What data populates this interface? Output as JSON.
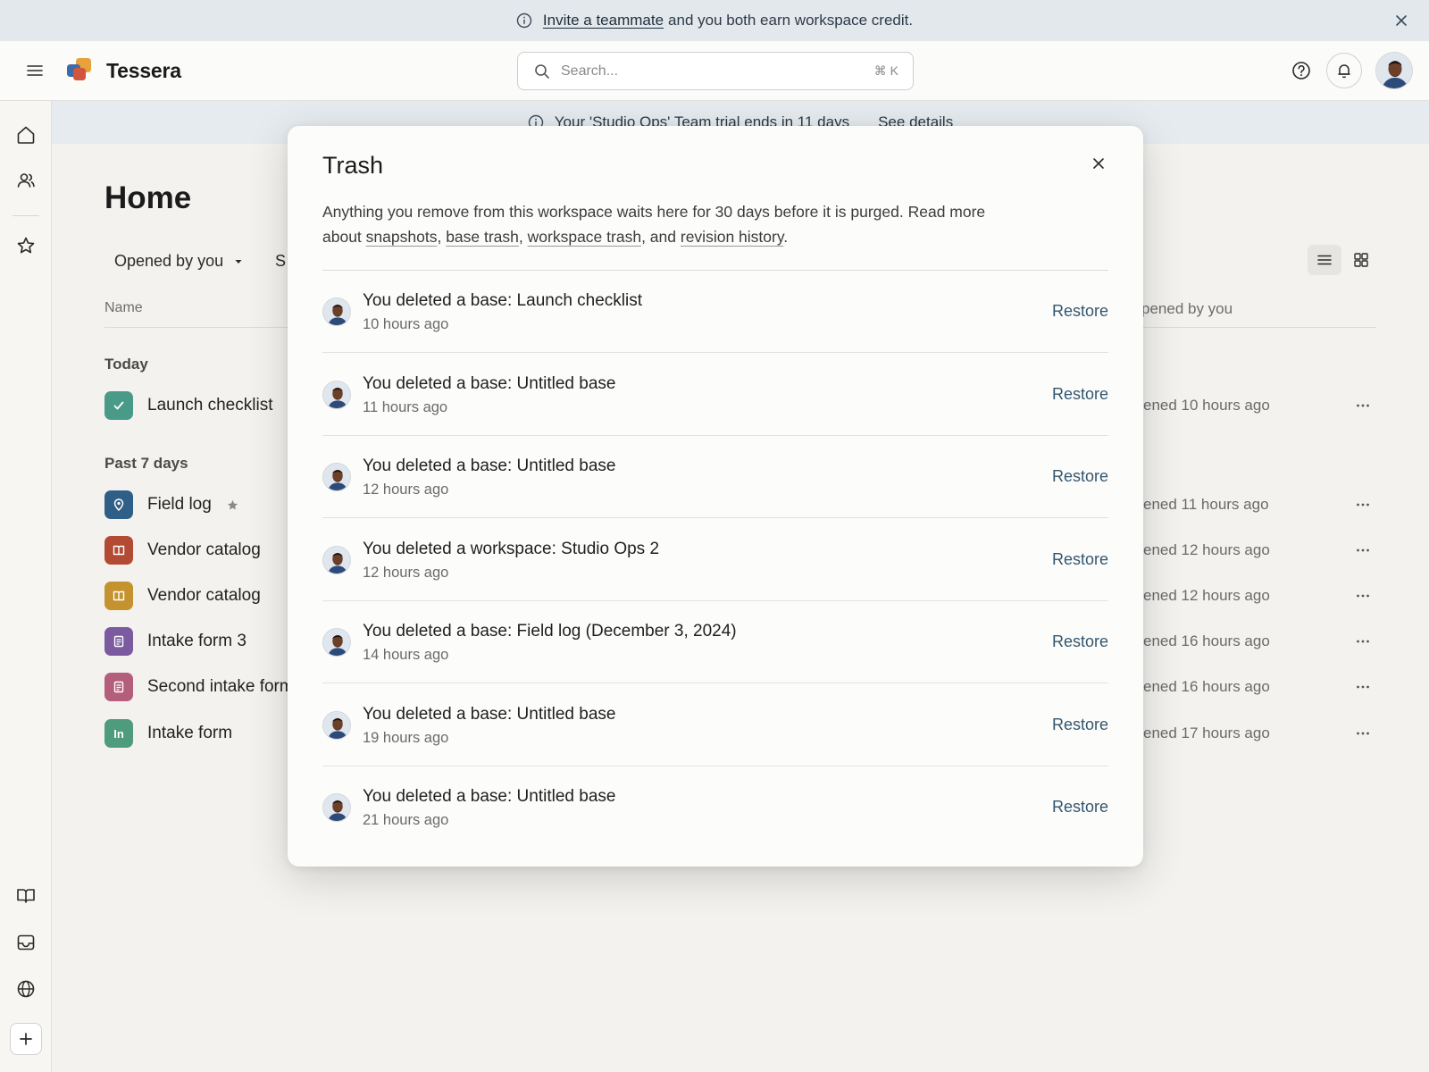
{
  "promo": {
    "link_text": "Invite a teammate",
    "rest_text": "and you both earn workspace credit."
  },
  "header": {
    "brand": "Tessera",
    "search_placeholder": "Search...",
    "search_shortcut": "⌘ K"
  },
  "trial_banner": {
    "text": "Your 'Studio Ops' Team trial ends in 11 days",
    "details_label": "See details"
  },
  "home": {
    "title": "Home",
    "filter_label": "Opened by you",
    "second_filter_fragment": "S",
    "columns": {
      "name": "Name",
      "opened_fragment": "pened by you"
    },
    "sections": {
      "today": "Today",
      "past7": "Past 7 days"
    },
    "rows": [
      {
        "name": "Launch checklist",
        "icon": "check-icon",
        "color": "#4a9a8a",
        "opened": "ened 10 hours ago",
        "starred": false
      },
      {
        "name": "Field log",
        "icon": "pin-icon",
        "color": "#2f5f86",
        "opened": "ened 11 hours ago",
        "starred": true
      },
      {
        "name": "Vendor catalog",
        "icon": "book-icon",
        "color": "#b34a34",
        "opened": "ened 12 hours ago",
        "starred": false
      },
      {
        "name": "Vendor catalog",
        "icon": "book-icon",
        "color": "#c4922e",
        "opened": "ened 12 hours ago",
        "starred": false
      },
      {
        "name": "Intake form 3",
        "icon": "form-icon",
        "color": "#7b5aa0",
        "opened": "ened 16 hours ago",
        "starred": false
      },
      {
        "name": "Second intake form",
        "icon": "form-icon",
        "color": "#b35f7b",
        "opened": "ened 16 hours ago",
        "starred": false
      },
      {
        "name": "Intake form",
        "icon": "In",
        "color": "#4f9b7e",
        "opened": "ened 17 hours ago",
        "starred": false
      }
    ]
  },
  "modal": {
    "title": "Trash",
    "desc_prefix": "Anything you remove from this workspace waits here for 30 days before it is purged. Read more about",
    "link_snapshots": "snapshots",
    "link_base_trash": "base trash",
    "link_workspace_trash": "workspace trash",
    "link_revision_history": "revision history",
    "and_text": "and",
    "restore_label": "Restore",
    "items": [
      {
        "title": "You deleted a base: Launch checklist",
        "time": "10 hours ago"
      },
      {
        "title": "You deleted a base: Untitled base",
        "time": "11 hours ago"
      },
      {
        "title": "You deleted a base: Untitled base",
        "time": "12 hours ago"
      },
      {
        "title": "You deleted a workspace: Studio Ops 2",
        "time": "12 hours ago"
      },
      {
        "title": "You deleted a base: Field log (December 3, 2024)",
        "time": "14 hours ago"
      },
      {
        "title": "You deleted a base: Untitled base",
        "time": "19 hours ago"
      },
      {
        "title": "You deleted a base: Untitled base",
        "time": "21 hours ago"
      }
    ]
  },
  "colors": {
    "accent_link": "#33566f",
    "banner_bg": "#e3e8ec"
  }
}
